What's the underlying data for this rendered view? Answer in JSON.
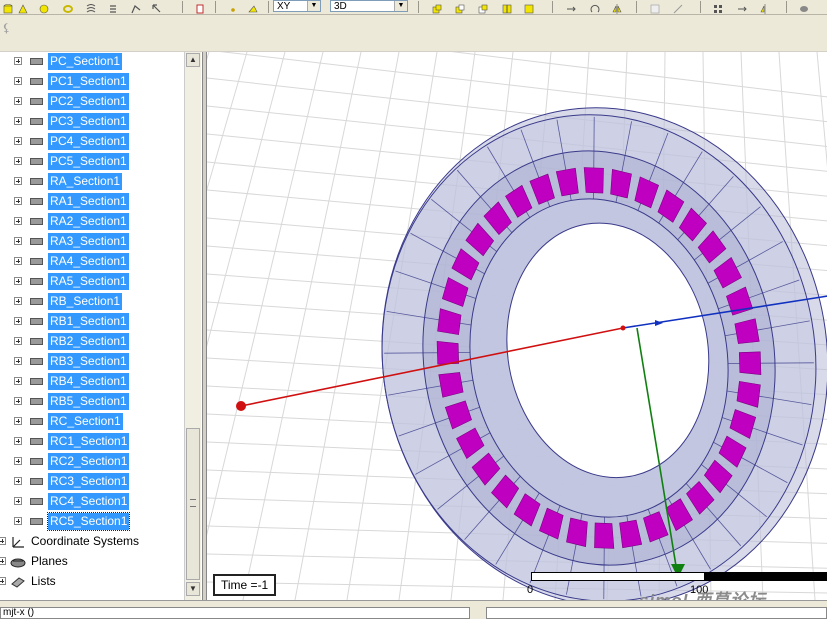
{
  "toolbar": {
    "plane_select": "XY",
    "mode_select": "3D",
    "icons": [
      "cylinder-icon",
      "cone-icon",
      "sphere-icon",
      "torus-icon",
      "helix-icon",
      "spiral-icon",
      "polyline-icon",
      "box-icon",
      "point-icon",
      "plane-icon",
      "unite-icon",
      "subtract-icon",
      "intersect-icon",
      "split-icon",
      "imprint-icon",
      "move-icon",
      "rotate-icon",
      "mirror-icon",
      "sweep-icon",
      "surface-icon",
      "render-icon"
    ]
  },
  "tree": {
    "items": [
      {
        "label": "PC_Section1"
      },
      {
        "label": "PC1_Section1"
      },
      {
        "label": "PC2_Section1"
      },
      {
        "label": "PC3_Section1"
      },
      {
        "label": "PC4_Section1"
      },
      {
        "label": "PC5_Section1"
      },
      {
        "label": "RA_Section1"
      },
      {
        "label": "RA1_Section1"
      },
      {
        "label": "RA2_Section1"
      },
      {
        "label": "RA3_Section1"
      },
      {
        "label": "RA4_Section1"
      },
      {
        "label": "RA5_Section1"
      },
      {
        "label": "RB_Section1"
      },
      {
        "label": "RB1_Section1"
      },
      {
        "label": "RB2_Section1"
      },
      {
        "label": "RB3_Section1"
      },
      {
        "label": "RB4_Section1"
      },
      {
        "label": "RB5_Section1"
      },
      {
        "label": "RC_Section1"
      },
      {
        "label": "RC1_Section1"
      },
      {
        "label": "RC2_Section1"
      },
      {
        "label": "RC3_Section1"
      },
      {
        "label": "RC4_Section1"
      },
      {
        "label": "RC5_Section1"
      }
    ],
    "folders": [
      {
        "label": "Coordinate Systems",
        "icon": "coordinate-systems-icon"
      },
      {
        "label": "Planes",
        "icon": "planes-icon"
      },
      {
        "label": "Lists",
        "icon": "lists-icon"
      }
    ]
  },
  "viewport": {
    "time_label": "Time =-1",
    "scale_min": "0",
    "scale_max": "100",
    "watermark": "simol 西莫论坛",
    "colors": {
      "x_axis": "#d01010",
      "y_axis": "#1030c0",
      "z_axis": "#108010",
      "coil": "#c000c0",
      "core_edges": "#3a3a8a",
      "grid": "#d8d8d8"
    }
  },
  "statusbar": {
    "text": "mjt-x ()"
  }
}
